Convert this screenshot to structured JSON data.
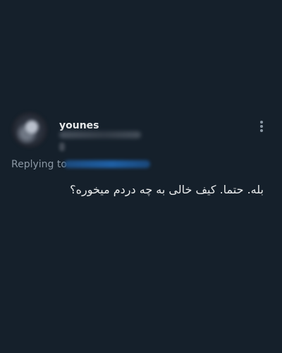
{
  "tweet": {
    "author": {
      "display_name": "younes",
      "avatar": "avatar"
    },
    "reply": {
      "label": "Replying to"
    },
    "text": "بله. حتما. کیف خالی به چه دردم میخوره؟",
    "more_icon": "more-options-icon"
  }
}
